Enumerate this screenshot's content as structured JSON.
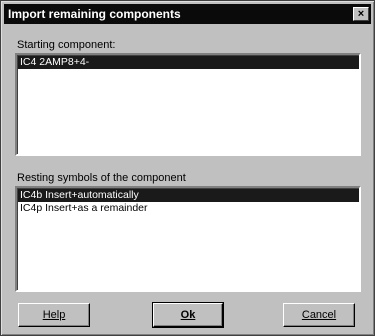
{
  "window": {
    "title": "Import remaining components",
    "close_label": "×"
  },
  "starting": {
    "label": "Starting component:",
    "items": [
      {
        "text": "IC4  2AMP8+4-",
        "selected": true
      }
    ]
  },
  "resting": {
    "label": "Resting symbols of the component",
    "items": [
      {
        "text": "IC4b  Insert+automatically",
        "selected": true
      },
      {
        "text": "IC4p  Insert+as a remainder",
        "selected": false
      }
    ]
  },
  "buttons": {
    "help": "Help",
    "ok": "Ok",
    "cancel": "Cancel"
  }
}
